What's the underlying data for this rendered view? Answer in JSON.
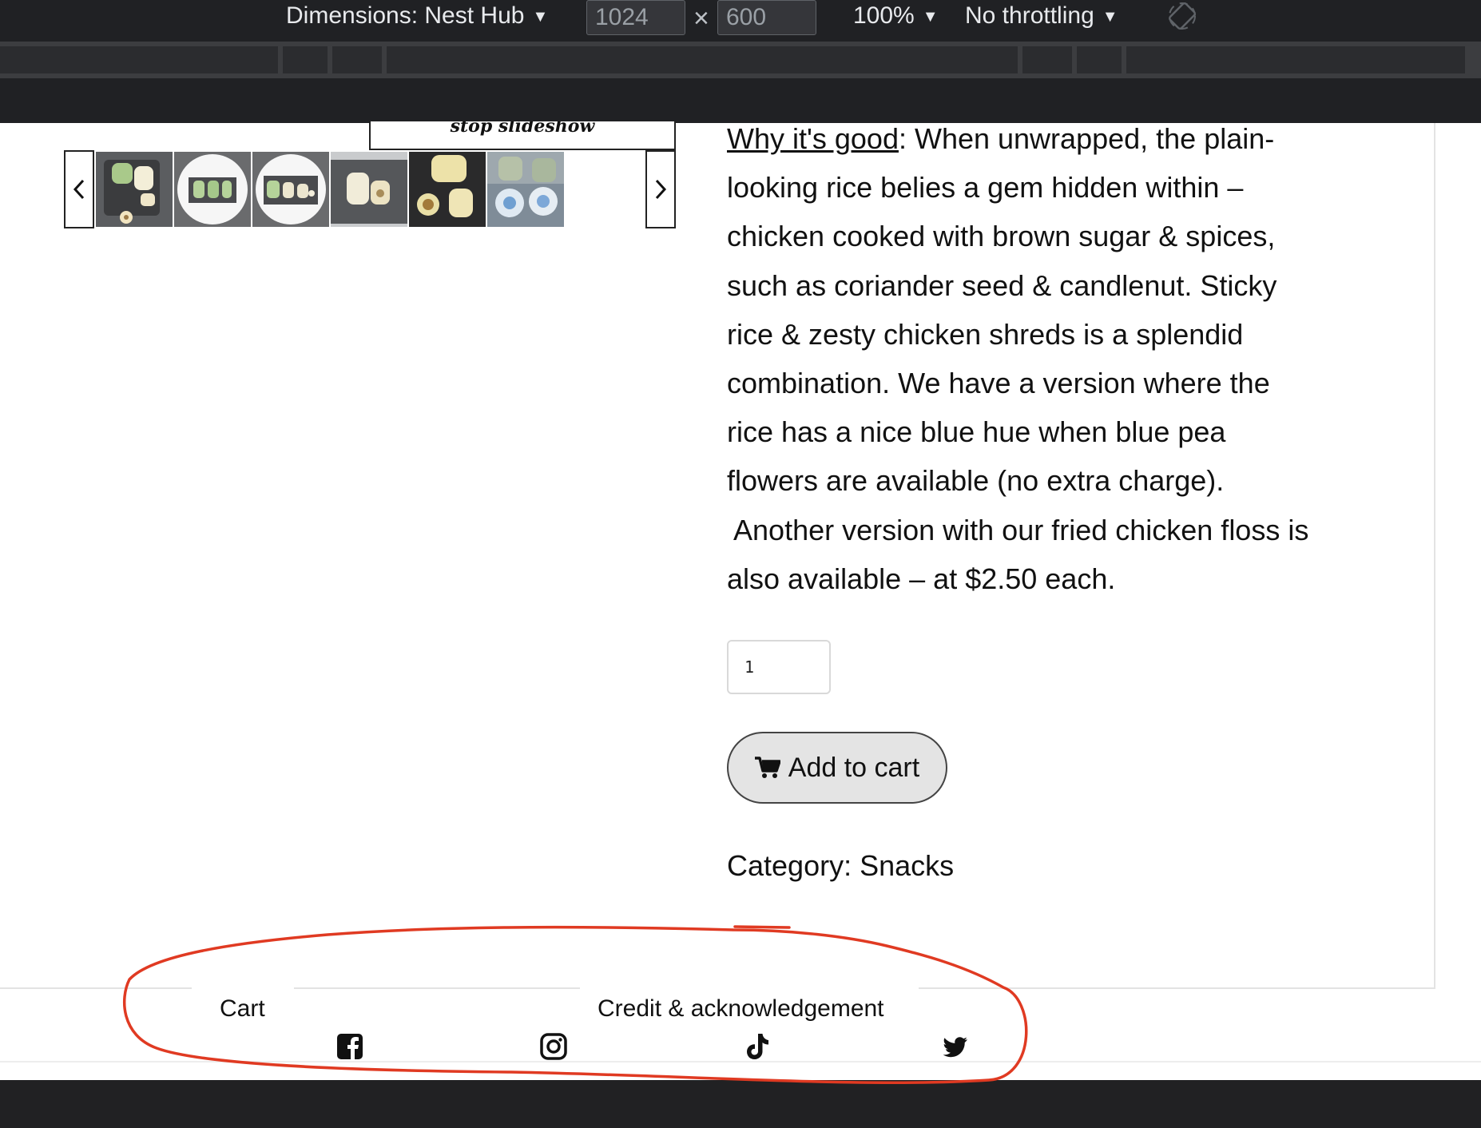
{
  "devtools": {
    "dimensions_label": "Dimensions: Nest Hub",
    "width_value": "1024",
    "height_value": "600",
    "times_symbol": "×",
    "zoom": "100%",
    "throttling": "No throttling",
    "caret": "▼"
  },
  "slideshow": {
    "stop_label": "stop slideshow",
    "prev_symbol": "‹",
    "next_symbol": "›",
    "thumbnail_count": 6
  },
  "product": {
    "why_label": "Why it's good",
    "description_lines": [
      ":   When unwrapped, the plain-",
      "looking rice belies a gem hidden within –",
      "chicken cooked with brown sugar & spices,",
      "such as coriander seed & candlenut.  Sticky",
      "rice & zesty chicken shreds is a splendid",
      "combination.  We have a version where the",
      "rice has a nice blue hue when blue pea",
      "flowers are available (no extra charge).",
      " Another version with our fried chicken floss is",
      "also available – at $2.50 each."
    ],
    "quantity": "1",
    "add_to_cart_label": "Add to cart",
    "category_label": "Category: ",
    "category_value": "Snacks"
  },
  "footer": {
    "links": [
      "Cart",
      "Credit & acknowledgement"
    ],
    "social_icons": [
      "facebook-icon",
      "instagram-icon",
      "tiktok-icon",
      "twitter-icon"
    ]
  },
  "colors": {
    "devtools_bg": "#202124",
    "annotation_red": "#e03a22",
    "button_bg": "#e4e4e4"
  }
}
